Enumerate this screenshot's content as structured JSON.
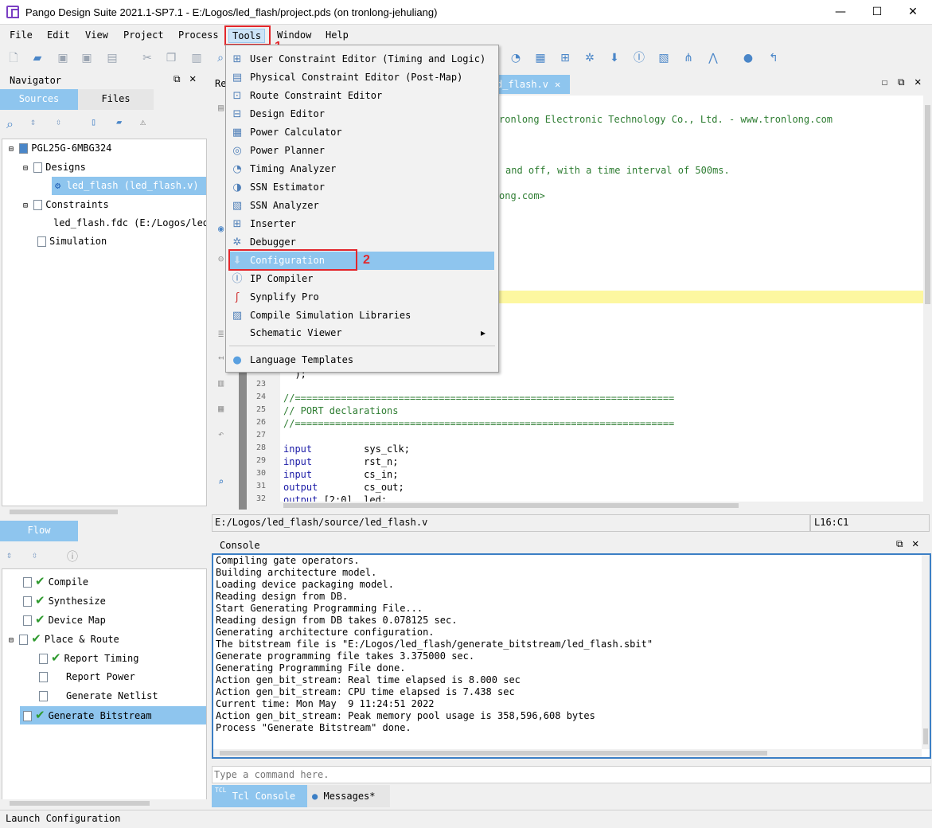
{
  "window": {
    "title": "Pango Design Suite 2021.1-SP7.1 - E:/Logos/led_flash/project.pds (on tronlong-jehuliang)",
    "minimize": "—",
    "maximize": "☐",
    "close": "✕"
  },
  "menubar": [
    "File",
    "Edit",
    "View",
    "Project",
    "Process",
    "Tools",
    "Window",
    "Help"
  ],
  "annotations": {
    "step1": "1",
    "step2": "2"
  },
  "tools_menu": {
    "items": [
      "User Constraint Editor (Timing and Logic)",
      "Physical Constraint Editor (Post-Map)",
      "Route Constraint Editor",
      "Design Editor",
      "Power Calculator",
      "Power Planner",
      "Timing Analyzer",
      "SSN Estimator",
      "SSN Analyzer",
      "Inserter",
      "Debugger",
      "Configuration",
      "IP Compiler",
      "Synplify Pro",
      "Compile Simulation Libraries",
      "Schematic Viewer",
      "Language Templates"
    ],
    "highlighted": "Configuration",
    "submenu_arrow": "▸"
  },
  "navigator": {
    "title": "Navigator",
    "tabs": [
      "Sources",
      "Files"
    ],
    "tree": {
      "device": "PGL25G-6MBG324",
      "designs": "Designs",
      "design_file": "led_flash (led_flash.v)",
      "constraints": "Constraints",
      "constraint_file": "led_flash.fdc (E:/Logos/led_",
      "simulation": "Simulation"
    }
  },
  "flow": {
    "title": "Flow",
    "steps": [
      "Compile",
      "Synthesize",
      "Device Map",
      "Place & Route",
      "Report Timing",
      "Report Power",
      "Generate Netlist",
      "Generate Bitstream"
    ]
  },
  "editor": {
    "tab_left": "Re",
    "tab_file": "d_flash.v",
    "header_text": "ronlong Electronic Technology Co., Ltd. - www.tronlong.com",
    "desc_text": "and off, with a time interval of 500ms.",
    "email_text": "ong.com>",
    "lines": [
      {
        "n": "23",
        "t": "  );"
      },
      {
        "n": "24",
        "t": "//=================================================================="
      },
      {
        "n": "25",
        "t": "// PORT declarations"
      },
      {
        "n": "26",
        "t": "//=================================================================="
      },
      {
        "n": "27",
        "t": ""
      },
      {
        "n": "28",
        "kw": "input",
        "t": "         sys_clk;"
      },
      {
        "n": "29",
        "kw": "input",
        "t": "         rst_n;"
      },
      {
        "n": "30",
        "kw": "input",
        "t": "         cs_in;"
      },
      {
        "n": "31",
        "kw": "output",
        "t": "        cs_out;"
      },
      {
        "n": "32",
        "kw": "output",
        "t": " [2:0]  led;"
      }
    ],
    "status_path": "E:/Logos/led_flash/source/led_flash.v",
    "status_pos": "L16:C1"
  },
  "console": {
    "title": "Console",
    "lines": [
      "Compiling gate operators.",
      "Building architecture model.",
      "Loading device packaging model.",
      "Reading design from DB.",
      "Start Generating Programming File...",
      "Reading design from DB takes 0.078125 sec.",
      "Generating architecture configuration.",
      "The bitstream file is \"E:/Logos/led_flash/generate_bitstream/led_flash.sbit\"",
      "Generate programming file takes 3.375000 sec.",
      "Generating Programming File done.",
      "Action gen_bit_stream: Real time elapsed is 8.000 sec",
      "Action gen_bit_stream: CPU time elapsed is 7.438 sec",
      "Current time: Mon May  9 11:24:51 2022",
      "Action gen_bit_stream: Peak memory pool usage is 358,596,608 bytes",
      "Process \"Generate Bitstream\" done."
    ],
    "input_placeholder": "Type a command here.",
    "tabs": [
      "Tcl Console",
      "Messages*"
    ],
    "tcl_badge": "TCL"
  },
  "statusbar": "Launch Configuration"
}
